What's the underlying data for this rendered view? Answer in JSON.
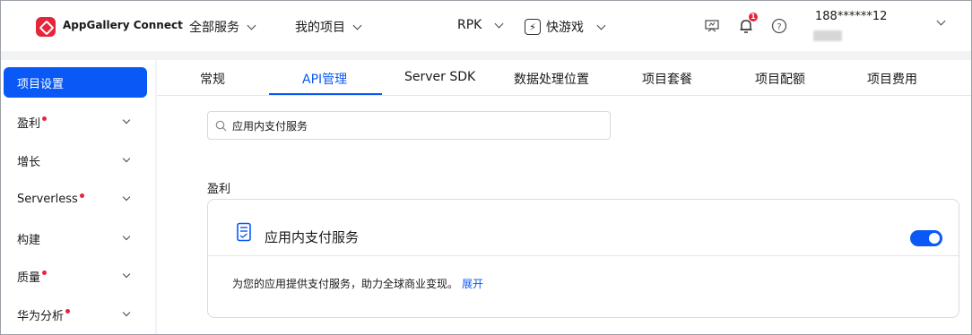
{
  "header": {
    "brand": "AppGallery Connect",
    "menu_all_services": "全部服务",
    "menu_my_projects": "我的项目",
    "rpk": "RPK",
    "app_type": "快游戏",
    "notification_count": "1",
    "user_id": "188******12",
    "brand_color": "#e6243a"
  },
  "sidebar": {
    "items": [
      {
        "label": "项目设置",
        "active": true,
        "dot": false,
        "expandable": false
      },
      {
        "label": "盈利",
        "active": false,
        "dot": true,
        "expandable": true
      },
      {
        "label": "增长",
        "active": false,
        "dot": false,
        "expandable": true
      },
      {
        "label": "Serverless",
        "active": false,
        "dot": true,
        "expandable": true
      },
      {
        "label": "构建",
        "active": false,
        "dot": false,
        "expandable": true
      },
      {
        "label": "质量",
        "active": false,
        "dot": true,
        "expandable": true
      },
      {
        "label": "华为分析",
        "active": false,
        "dot": true,
        "expandable": true
      }
    ]
  },
  "tabs": [
    {
      "label": "常规",
      "active": false
    },
    {
      "label": "API管理",
      "active": true
    },
    {
      "label": "Server SDK",
      "active": false
    },
    {
      "label": "数据处理位置",
      "active": false
    },
    {
      "label": "项目套餐",
      "active": false
    },
    {
      "label": "项目配额",
      "active": false
    },
    {
      "label": "项目费用",
      "active": false
    }
  ],
  "search": {
    "value": "应用内支付服务"
  },
  "section": {
    "title": "盈利"
  },
  "service_card": {
    "name": "应用内支付服务",
    "enabled": true,
    "description": "为您的应用提供支付服务，助力全球商业变现。",
    "expand_link": "展开",
    "accent_color": "#0a59f7"
  }
}
